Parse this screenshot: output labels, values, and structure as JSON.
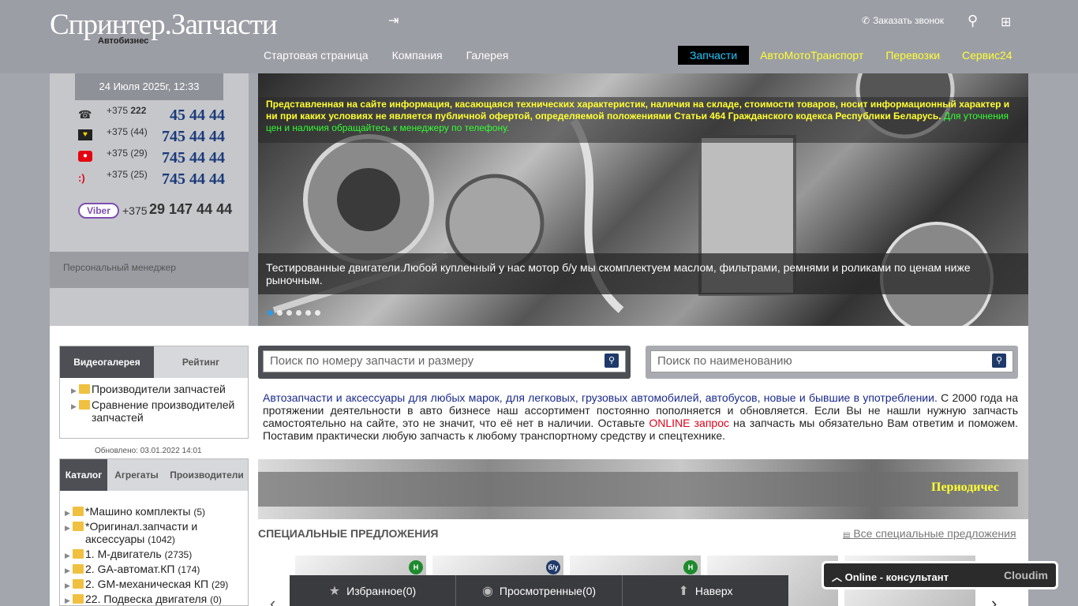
{
  "header": {
    "logo": "Спринтер.Запчасти",
    "logo_sub": "Автобизнес",
    "callback": "Заказать звонок",
    "nav_left": [
      "Стартовая страница",
      "Компания",
      "Галерея"
    ],
    "nav_right": [
      "Запчасти",
      "АвтоМотоТранспорт",
      "Перевозки",
      "Сервис24"
    ],
    "active_nav": "Запчасти"
  },
  "contacts": {
    "date": "24 Июля 2025г, 12:33",
    "phones": [
      {
        "icon": "phone-icon",
        "code_prefix": "+375",
        "code_bold": "222",
        "number": "45 44 44"
      },
      {
        "icon": "velcom-icon",
        "code_prefix": "+375 (44)",
        "code_bold": "",
        "number": "745 44 44"
      },
      {
        "icon": "mts-icon",
        "code_prefix": "+375 (29)",
        "code_bold": "",
        "number": "745 44 44"
      },
      {
        "icon": "life-icon",
        "code_prefix": "+375 (25)",
        "code_bold": "",
        "number": "745 44 44"
      }
    ],
    "viber_label": "Viber",
    "viber_code": "+375",
    "viber_number": "29 147 44 44",
    "manager": "Персональный менеджер"
  },
  "hero": {
    "notice_yellow": "Представленная на сайте информация, касающаяся технических характеристик, наличия на складе, стоимости товаров, носит информационный характер и ни при каких условиях не является публичной офертой, определяемой положениями Статьи 464 Гражданского кодекса Республики Беларусь.",
    "notice_green": "Для уточнения цен и наличия обращайтесь к менеджеру по телефону.",
    "caption": "Тестированные двигатели.Любой купленный у нас мотор б/у мы скомплектуем маслом, фильтрами, ремнями и роликами по ценам ниже рыночным."
  },
  "tabs1": {
    "tabs": [
      "Видеогалерея",
      "Рейтинг"
    ],
    "items": [
      "Производители запчастей",
      "Сравнение производителей запчастей"
    ],
    "updated": "Обновлено: 03.01.2022 14:01"
  },
  "tabs2": {
    "tabs": [
      "Каталог",
      "Агрегаты",
      "Производители"
    ],
    "items": [
      {
        "label": "*Машино комплекты",
        "count": "(5)"
      },
      {
        "label": "*Оригинал.запчасти и аксессуары",
        "count": "(1042)"
      },
      {
        "label": "1. М-двигатель",
        "count": "(2735)"
      },
      {
        "label": "2. GA-автомат.КП",
        "count": "(174)"
      },
      {
        "label": "2. GM-механическая КП",
        "count": "(29)"
      },
      {
        "label": "22. Подвеска двигателя",
        "count": "(0)"
      }
    ]
  },
  "search": {
    "part_placeholder": "Поиск по номеру запчасти и размеру",
    "name_placeholder": "Поиск по наименованию"
  },
  "intro": {
    "part1": "Автозапчасти и аксессуары для любых марок, для легковых, грузовых автомобилей, автобусов, новые и бывшие в употреблении.",
    "part2": " С 2000 года на протяжении деятельности в авто бизнесе наш ассортимент постоянно пополняется и обновляется. Если Вы не нашли нужную запчасть самостоятельно на сайте, это не значит, что её нет в наличии. Оставьте ",
    "online": "ONLINE запрос",
    "part3": " на запчасть мы обязательно Вам ответим и поможем. Поставим практически любую запчасть к любому транспортному средству и спецтехнике."
  },
  "banner": {
    "text": "Периодичес"
  },
  "special": {
    "title": "СПЕЦИАЛЬНЫЕ ПРЕДЛОЖЕНИЯ",
    "all_link": "Все специальные предложения"
  },
  "cards": [
    {
      "tag": "Н",
      "type": "new"
    },
    {
      "tag": "б/у",
      "type": "used"
    },
    {
      "tag": "Н",
      "type": "new"
    },
    {
      "tag": "",
      "type": "none"
    },
    {
      "tag": "",
      "type": "none"
    }
  ],
  "bottom_bar": {
    "favorites": "Избранное(0)",
    "viewed": "Просмотренные(0)",
    "up": "Наверх"
  },
  "consultant": {
    "label": "Online - консультант",
    "brand": "Cloudim"
  }
}
